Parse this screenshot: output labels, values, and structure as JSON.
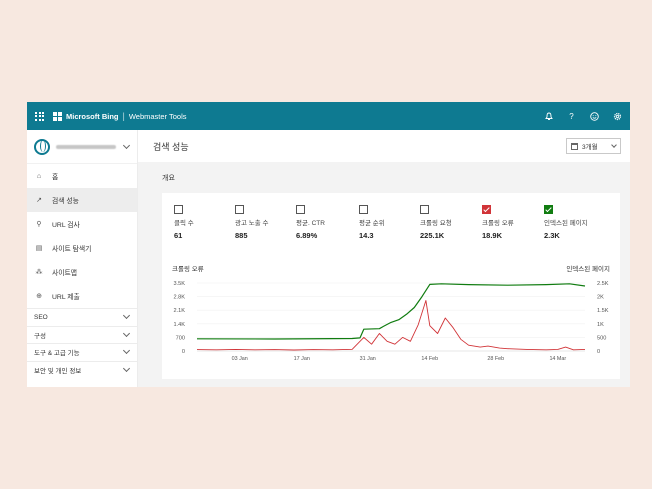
{
  "header": {
    "brand": "Microsoft Bing",
    "product": "Webmaster Tools"
  },
  "icons": {
    "notifications": "bell-icon",
    "help": "help-icon",
    "feedback": "smiley-icon",
    "settings": "gear-icon"
  },
  "sidebar": {
    "nav": [
      {
        "label": "홈",
        "icon": "home-icon"
      },
      {
        "label": "검색 성능",
        "icon": "trend-icon"
      },
      {
        "label": "URL 검사",
        "icon": "search-icon"
      },
      {
        "label": "사이트 탐색기",
        "icon": "document-icon"
      },
      {
        "label": "사이트맵",
        "icon": "sitemap-icon"
      },
      {
        "label": "URL 제출",
        "icon": "globe-icon"
      }
    ],
    "sections": [
      "SEO",
      "구성",
      "도구 & 고급 기능",
      "보안 및 개인 정보"
    ]
  },
  "main": {
    "title": "검색 성능",
    "range": "3개월",
    "overview": "개요",
    "metrics": [
      {
        "label": "클릭 수",
        "value": "61",
        "checked": false
      },
      {
        "label": "광고 노출 수",
        "value": "885",
        "checked": false
      },
      {
        "label": "평균. CTR",
        "value": "6.89%",
        "checked": false
      },
      {
        "label": "평균 순위",
        "value": "14.3",
        "checked": false
      },
      {
        "label": "크롤링 요청",
        "value": "225.1K",
        "checked": false
      },
      {
        "label": "크롤링 오류",
        "value": "18.9K",
        "checked": true,
        "color": "#d13438"
      },
      {
        "label": "인덱스된 페이지",
        "value": "2.3K",
        "checked": true,
        "color": "#107c10"
      }
    ],
    "chart_left_title": "크롤링 오류",
    "chart_right_title": "인덱스된 페이지"
  },
  "chart_data": {
    "type": "line",
    "x_ticks": [
      "03 Jan",
      "17 Jan",
      "31 Jan",
      "14 Feb",
      "28 Feb",
      "14 Mar"
    ],
    "y_left_ticks": [
      "3.5K",
      "2.8K",
      "2.1K",
      "1.4K",
      "700",
      "0"
    ],
    "y_right_ticks": [
      "2.5K",
      "2K",
      "1.5K",
      "1K",
      "500",
      "0"
    ],
    "ylim_left": [
      0,
      3500
    ],
    "ylim_right": [
      0,
      2500
    ],
    "series": [
      {
        "name": "크롤링 오류",
        "axis": "left",
        "color": "#d13438",
        "points": [
          [
            0,
            70
          ],
          [
            0.05,
            60
          ],
          [
            0.1,
            80
          ],
          [
            0.15,
            60
          ],
          [
            0.2,
            70
          ],
          [
            0.25,
            50
          ],
          [
            0.3,
            70
          ],
          [
            0.35,
            60
          ],
          [
            0.4,
            90
          ],
          [
            0.43,
            700
          ],
          [
            0.45,
            350
          ],
          [
            0.47,
            900
          ],
          [
            0.49,
            500
          ],
          [
            0.51,
            350
          ],
          [
            0.53,
            700
          ],
          [
            0.55,
            500
          ],
          [
            0.57,
            1350
          ],
          [
            0.59,
            2600
          ],
          [
            0.6,
            1300
          ],
          [
            0.62,
            900
          ],
          [
            0.64,
            1700
          ],
          [
            0.66,
            1200
          ],
          [
            0.68,
            600
          ],
          [
            0.7,
            300
          ],
          [
            0.73,
            200
          ],
          [
            0.75,
            250
          ],
          [
            0.78,
            150
          ],
          [
            0.8,
            120
          ],
          [
            0.85,
            80
          ],
          [
            0.9,
            60
          ],
          [
            0.93,
            80
          ],
          [
            0.95,
            200
          ],
          [
            0.97,
            60
          ],
          [
            1,
            80
          ]
        ]
      },
      {
        "name": "인덱스된 페이지",
        "axis": "right",
        "color": "#107c10",
        "points": [
          [
            0,
            450
          ],
          [
            0.2,
            440
          ],
          [
            0.4,
            460
          ],
          [
            0.42,
            480
          ],
          [
            0.43,
            800
          ],
          [
            0.47,
            820
          ],
          [
            0.48,
            900
          ],
          [
            0.5,
            1050
          ],
          [
            0.52,
            1150
          ],
          [
            0.54,
            1350
          ],
          [
            0.56,
            1600
          ],
          [
            0.58,
            2000
          ],
          [
            0.6,
            2450
          ],
          [
            0.63,
            2470
          ],
          [
            0.7,
            2440
          ],
          [
            0.8,
            2420
          ],
          [
            0.9,
            2440
          ],
          [
            0.96,
            2470
          ],
          [
            1,
            2390
          ]
        ]
      }
    ]
  }
}
